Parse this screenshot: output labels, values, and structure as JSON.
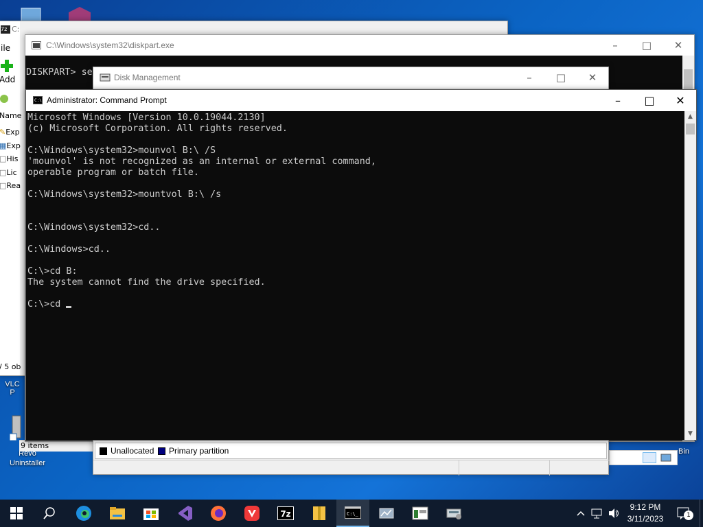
{
  "desktop": {
    "icons": [
      {
        "label": "VLC",
        "sub": "P"
      },
      {
        "label": "Revo Uninstaller"
      },
      {
        "label": "Bin"
      }
    ]
  },
  "window_7zip": {
    "title": "C:",
    "menu_file": "ile",
    "add_label": "Add",
    "column_name": "Name",
    "items": [
      "Exp",
      "Exp",
      "His",
      "Lic",
      "Rea"
    ],
    "status_left": "/ 5 ob",
    "items_count": "9 items"
  },
  "window_diskpart": {
    "title": "C:\\Windows\\system32\\diskpart.exe",
    "prompt": "DISKPART> se"
  },
  "window_diskmgmt": {
    "title": "Disk Management",
    "legend": [
      {
        "label": "Unallocated",
        "color": "#000000"
      },
      {
        "label": "Primary partition",
        "color": "#00007f"
      }
    ]
  },
  "window_cmd": {
    "title": "Administrator: Command Prompt",
    "lines": [
      "Microsoft Windows [Version 10.0.19044.2130]",
      "(c) Microsoft Corporation. All rights reserved.",
      "",
      "C:\\Windows\\system32>mounvol B:\\ /S",
      "'mounvol' is not recognized as an internal or external command,",
      "operable program or batch file.",
      "",
      "C:\\Windows\\system32>mountvol B:\\ /s",
      "",
      "",
      "C:\\Windows\\system32>cd..",
      "",
      "C:\\Windows>cd..",
      "",
      "C:\\>cd B:",
      "The system cannot find the drive specified.",
      ""
    ],
    "current_input": "C:\\>cd "
  },
  "taskbar": {
    "time": "9:12 PM",
    "date": "3/11/2023",
    "notification_count": "1",
    "sevenzip_label": "7z",
    "apps": [
      "start",
      "search",
      "edge",
      "file-explorer",
      "store",
      "visual-studio",
      "firefox",
      "vivaldi",
      "7zip",
      "folder",
      "command-prompt",
      "disk-tool",
      "disk-management",
      "settings-tool"
    ]
  },
  "colors": {
    "console_bg": "#0c0c0c",
    "console_fg": "#cccccc",
    "taskbar_bg": "#0f1b2d",
    "accent": "#76b9ed"
  }
}
